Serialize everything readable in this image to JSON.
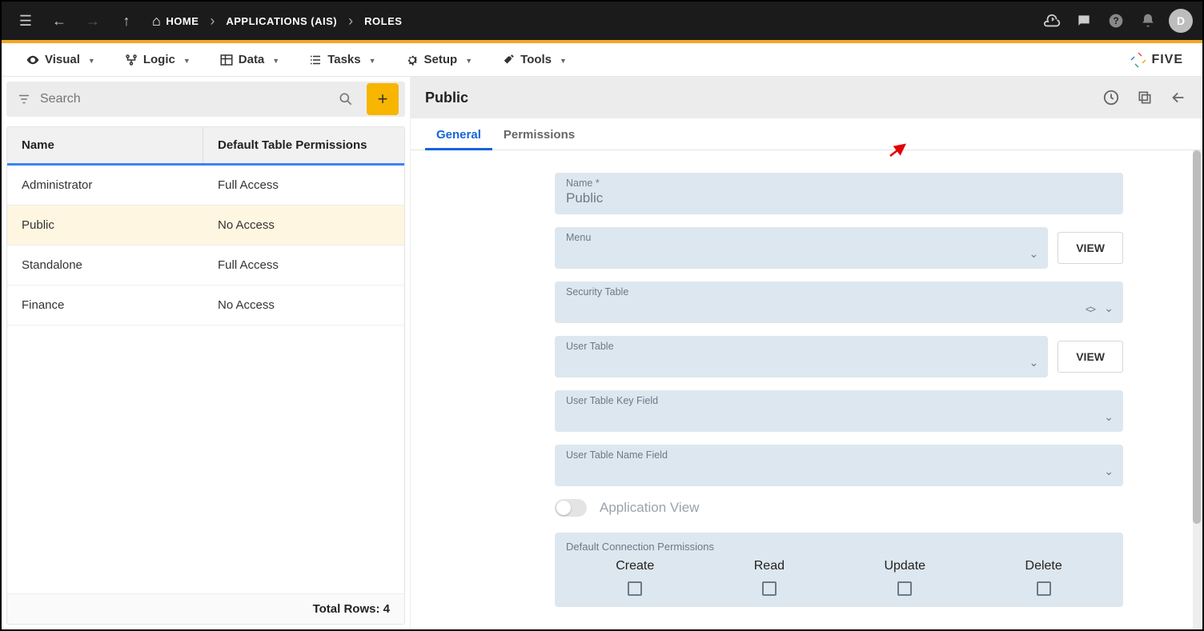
{
  "topbar": {
    "breadcrumbs": [
      "HOME",
      "APPLICATIONS (AIS)",
      "ROLES"
    ],
    "avatar_initial": "D"
  },
  "menubar": {
    "items": [
      {
        "label": "Visual"
      },
      {
        "label": "Logic"
      },
      {
        "label": "Data"
      },
      {
        "label": "Tasks"
      },
      {
        "label": "Setup"
      },
      {
        "label": "Tools"
      }
    ],
    "brand": "FIVE"
  },
  "leftpanel": {
    "search_placeholder": "Search",
    "columns": {
      "c1": "Name",
      "c2": "Default Table Permissions"
    },
    "rows": [
      {
        "name": "Administrator",
        "perm": "Full Access",
        "selected": false
      },
      {
        "name": "Public",
        "perm": "No Access",
        "selected": true
      },
      {
        "name": "Standalone",
        "perm": "Full Access",
        "selected": false
      },
      {
        "name": "Finance",
        "perm": "No Access",
        "selected": false
      }
    ],
    "footer": "Total Rows: 4"
  },
  "rightpanel": {
    "title": "Public",
    "tabs": [
      {
        "label": "General",
        "active": true
      },
      {
        "label": "Permissions",
        "active": false
      }
    ],
    "view_button": "VIEW",
    "form": {
      "name_label": "Name *",
      "name_value": "Public",
      "menu_label": "Menu",
      "security_table_label": "Security Table",
      "user_table_label": "User Table",
      "user_table_key_label": "User Table Key Field",
      "user_table_name_label": "User Table Name Field",
      "app_view_label": "Application View",
      "perm_section_label": "Default Connection Permissions",
      "perm_cols": [
        "Create",
        "Read",
        "Update",
        "Delete"
      ]
    }
  }
}
